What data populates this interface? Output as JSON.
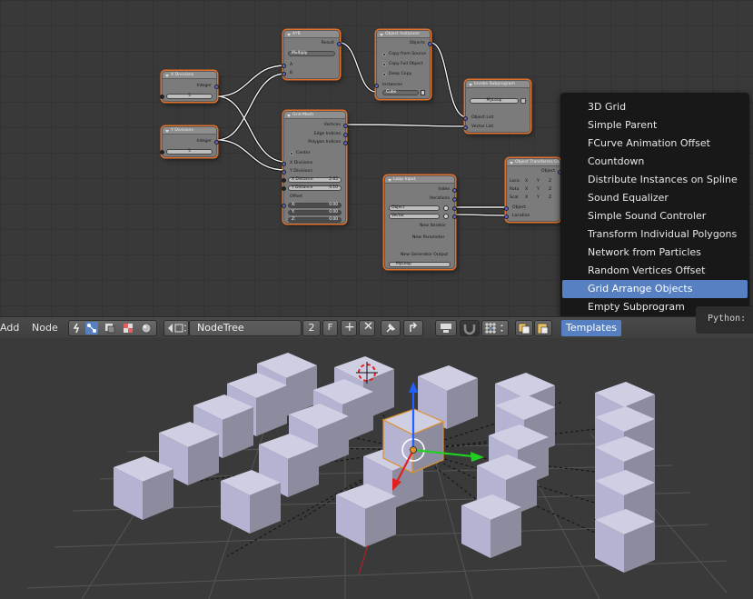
{
  "nodes": {
    "a_times_b": {
      "title": "A*B",
      "output": "Result",
      "operation": "Multiply",
      "input_a": "A",
      "input_b": "B"
    },
    "x_divisions": {
      "title": "X Divisions",
      "output": "Integer",
      "value": "5"
    },
    "y_divisions": {
      "title": "Y Divisions",
      "output": "Integer",
      "value": "5"
    },
    "object_instancer": {
      "title": "Object Instancer",
      "output": "Objects",
      "options": [
        "Copy from Source",
        "Copy Full Object",
        "Deep Copy"
      ],
      "input": "Instances",
      "object_value": "Cube"
    },
    "invoke_subprogram": {
      "title": "Invoke Subprogram",
      "subprogram": "MyLoop",
      "inputs": [
        "Object List",
        "Vector List"
      ]
    },
    "grid_mesh": {
      "title": "Grid Mesh",
      "outputs": [
        "Vertices",
        "Edge Indices",
        "Polygon Indices"
      ],
      "center_label": "Center",
      "inputs": [
        "X Divisions",
        "Y Divisions"
      ],
      "x_distance_label": "X Distance",
      "x_distance": "2.65",
      "y_distance_label": "Y Distance",
      "y_distance": "4.10",
      "offset_label": "Offset",
      "offset": [
        {
          "axis": "X:",
          "value": "0.00"
        },
        {
          "axis": "Y:",
          "value": "0.00"
        },
        {
          "axis": "Z:",
          "value": "0.00"
        }
      ]
    },
    "loop_input": {
      "title": "Loop Input",
      "outputs": [
        "Index",
        "Iterations"
      ],
      "params": [
        "Object",
        "Vector"
      ],
      "new_iterator": "New Iterator",
      "new_parameter": "New Parameter",
      "new_generator": "New Generator Output",
      "loop_name": "MyLoop"
    },
    "object_transforms": {
      "title": "Object Transforms Ou",
      "input_object_top": "Object",
      "rows": [
        {
          "label": "Loca",
          "axes": [
            "X",
            "Y",
            "Z"
          ]
        },
        {
          "label": "Rota",
          "axes": [
            "X",
            "Y",
            "Z"
          ]
        },
        {
          "label": "Scal",
          "axes": [
            "X",
            "Y",
            "Z"
          ]
        }
      ],
      "inputs": [
        "Object",
        "Location"
      ]
    }
  },
  "templates_menu": {
    "items": [
      {
        "label": "3D Grid",
        "active": false
      },
      {
        "label": "Simple Parent",
        "active": false
      },
      {
        "label": "FCurve Animation Offset",
        "active": false
      },
      {
        "label": "Countdown",
        "active": false
      },
      {
        "label": "Distribute Instances on Spline",
        "active": false
      },
      {
        "label": "Sound Equalizer",
        "active": false
      },
      {
        "label": "Simple Sound Controler",
        "active": false
      },
      {
        "label": "Transform Individual Polygons",
        "active": false
      },
      {
        "label": "Network from Particles",
        "active": false
      },
      {
        "label": "Random Vertices Offset",
        "active": false
      },
      {
        "label": "Grid Arrange Objects",
        "active": true
      },
      {
        "label": "Empty Subprogram",
        "active": false
      }
    ]
  },
  "tooltip": {
    "text": "Python:"
  },
  "header": {
    "add_menu": "Add",
    "node_menu": "Node",
    "node_tree_name": "NodeTree",
    "users_count": "2",
    "fake_user": "F",
    "templates_label": "Templates"
  },
  "colors": {
    "selection_outline": "#e0702a",
    "menu_highlight": "#5680c2",
    "socket_vector": "#6363c7",
    "cube_fill": "#b4b4d2",
    "axis_z": "#2060ff",
    "axis_x": "#e02020",
    "axis_y": "#20d020"
  }
}
